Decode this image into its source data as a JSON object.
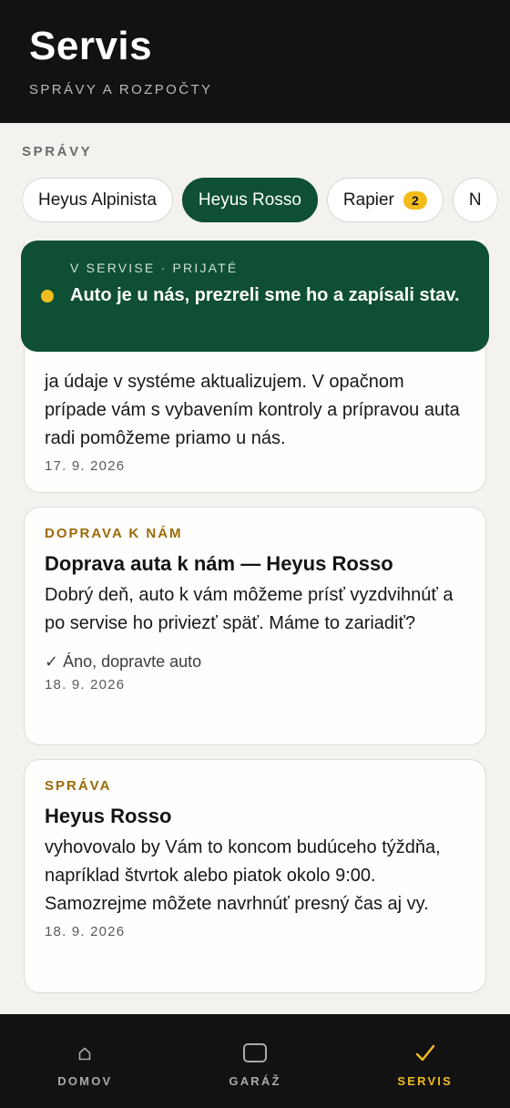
{
  "header": {
    "title": "Servis",
    "subtitle": "SPRÁVY A ROZPOČTY"
  },
  "section": {
    "label": "SPRÁVY"
  },
  "tabs": [
    {
      "label": "Heyus Alpinista",
      "badge": null,
      "active": false
    },
    {
      "label": "Heyus Rosso",
      "badge": null,
      "active": true
    },
    {
      "label": "Rapier",
      "badge": "2",
      "active": false
    },
    {
      "label": "N",
      "badge": null,
      "active": false
    }
  ],
  "status": {
    "kicker": "V SERVISE · PRIJATÉ",
    "text": "Auto je u nás, prezreli sme ho a zapísali stav.",
    "dot_color": "#f2bd1c"
  },
  "messages": [
    {
      "body": "ja údaje v systéme aktualizujem. V opačnom prípade vám s vybavením kontroly a prípravou auta radi pomôžeme priamo u nás.",
      "date": "17. 9. 2026"
    },
    {
      "tag": "DOPRAVA K NÁM",
      "title": "Doprava auta k nám — Heyus Rosso",
      "body": "Dobrý deň, auto k vám môžeme prísť vyzdvihnúť a po servise ho priviezť späť. Máme to zariadiť?",
      "reply": "✓ Áno, dopravte auto",
      "date": "18. 9. 2026"
    },
    {
      "tag": "SPRÁVA",
      "title": "Heyus Rosso",
      "body": "vyhovovalo by Vám to koncom budúceho týždňa, napríklad štvrtok alebo piatok okolo 9:00. Samozrejme môžete navrhnúť presný čas aj vy.",
      "date": "18. 9. 2026"
    }
  ],
  "nav": [
    {
      "label": "DOMOV",
      "icon": "home-icon",
      "active": false
    },
    {
      "label": "GARÁŽ",
      "icon": "garage-icon",
      "active": false
    },
    {
      "label": "SERVIS",
      "icon": "check-icon",
      "active": true
    }
  ],
  "colors": {
    "brand_green": "#0f4f33",
    "accent_yellow": "#f2bd1c",
    "tag_gold": "#9a6a07",
    "dark": "#121212"
  }
}
